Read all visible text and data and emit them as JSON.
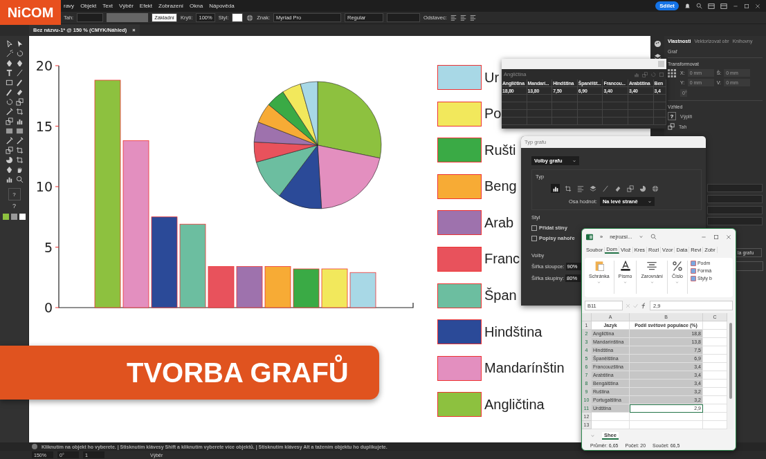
{
  "app": {
    "logo": "NiCOM",
    "menu": [
      "ravy",
      "Objekt",
      "Text",
      "Výběr",
      "Efekt",
      "Zobrazení",
      "Okna",
      "Nápověda"
    ],
    "share_button": "Sdílet"
  },
  "control_bar": {
    "stroke_label": "Tah:",
    "stroke_profile": "Základní",
    "opacity_label": "Krytí:",
    "opacity": "100%",
    "style_label": "Styl:",
    "char_label": "Znak:",
    "font": "Myriad Pro",
    "font_style": "Regular",
    "paragraph_label": "Odstavec:"
  },
  "document_tab": {
    "title": "Bez názvu-1* @ 150 % (CMYK/Náhled)",
    "close": "×"
  },
  "toolbar": {
    "fill_mark": "?",
    "stroke_mark": "?"
  },
  "canvas": {
    "chart_data": {
      "type": "bar",
      "ylim": [
        0,
        20
      ],
      "yticks": [
        0,
        5,
        10,
        15,
        20
      ],
      "series": [
        {
          "color": "#8dc13f",
          "values": [
            18.8
          ]
        },
        {
          "color": "#e38fbf",
          "values": [
            13.8
          ]
        },
        {
          "color": "#2b4a98",
          "values": [
            7.5
          ]
        },
        {
          "color": "#6cbea0",
          "values": [
            6.9
          ]
        },
        {
          "color": "#e8525c",
          "values": [
            3.4
          ]
        },
        {
          "color": "#9e72ad",
          "values": [
            3.4
          ]
        },
        {
          "color": "#f7ab35",
          "values": [
            3.4
          ]
        },
        {
          "color": "#3aaa45",
          "values": [
            3.2
          ]
        },
        {
          "color": "#f2e85c",
          "values": [
            3.2
          ]
        },
        {
          "color": "#a8d8e6",
          "values": [
            2.9
          ]
        }
      ]
    },
    "legend": [
      {
        "label": "Ur",
        "color": "#a8d8e6"
      },
      {
        "label": "Po",
        "color": "#f2e85c"
      },
      {
        "label": "Rušti",
        "color": "#3aaa45"
      },
      {
        "label": "Beng",
        "color": "#f7ab35"
      },
      {
        "label": "Arab",
        "color": "#9e72ad"
      },
      {
        "label": "Franc",
        "color": "#e8525c"
      },
      {
        "label": "Špan",
        "color": "#6cbea0"
      },
      {
        "label": "Hindština",
        "color": "#2b4a98"
      },
      {
        "label": "Mandarínštin",
        "color": "#e38fbf"
      },
      {
        "label": "Angličtina",
        "color": "#8dc13f"
      }
    ]
  },
  "banner": "TVORBA GRAFŮ",
  "properties_panel": {
    "tabs": [
      {
        "label": "Vlastnosti",
        "selected": true
      },
      {
        "label": "Vektorizovat obr",
        "selected": false
      },
      {
        "label": "Knihovny",
        "selected": false
      }
    ],
    "object": "Graf",
    "transform_title": "Transformovat",
    "fields": [
      {
        "label": "X:",
        "value": "0 mm"
      },
      {
        "label": "Š:",
        "value": "0 mm"
      },
      {
        "label": "Y:",
        "value": "0 mm"
      },
      {
        "label": "V:",
        "value": "0 mm"
      }
    ],
    "angle": "0°",
    "appearance_title": "Vzhled",
    "fill_mark": "?",
    "fill_label": "Výplň",
    "stroke_label": "Tah",
    "graph_button": "la grafu"
  },
  "data_window": {
    "cell_input": "Angličtina",
    "columns": [
      "Angličtina",
      "Mandarí...",
      "Hindština",
      "Španělšt...",
      "Francou...",
      "Arabština",
      "Ben"
    ],
    "values": [
      "18,80",
      "13,80",
      "7,50",
      "6,90",
      "3,40",
      "3,40",
      "3,4"
    ]
  },
  "chart_type_dialog": {
    "title": "Typ grafu",
    "section_dropdown": "Volby grafu",
    "type_title": "Typ",
    "chart_types": [
      {
        "kind": "column",
        "selected": true
      },
      {
        "kind": "stacked-column",
        "selected": false
      },
      {
        "kind": "bar",
        "selected": false
      },
      {
        "kind": "stacked-bar",
        "selected": false
      },
      {
        "kind": "line",
        "selected": false
      },
      {
        "kind": "area",
        "selected": false
      },
      {
        "kind": "scatter",
        "selected": false
      },
      {
        "kind": "pie",
        "selected": false
      },
      {
        "kind": "radar",
        "selected": false
      }
    ],
    "axis_label": "Osa hodnot:",
    "axis_value": "Na levé straně",
    "style_title": "Styl",
    "checkboxes": [
      {
        "label": "Přidat stíny",
        "checked": false
      },
      {
        "label": "Popisy nahoře",
        "checked": false
      }
    ],
    "options_title": "Volby",
    "options": [
      {
        "label": "Šířka sloupce:",
        "value": "90%"
      },
      {
        "label": "Šířka skupiny:",
        "value": "80%"
      }
    ]
  },
  "excel": {
    "file_name": "nejrozsi...",
    "more": "»",
    "ribbon_tabs": [
      {
        "label": "Soubor",
        "selected": false
      },
      {
        "label": "Dom",
        "selected": true
      },
      {
        "label": "Vlož",
        "selected": false
      },
      {
        "label": "Kres",
        "selected": false
      },
      {
        "label": "Rozl",
        "selected": false
      },
      {
        "label": "Vzor",
        "selected": false
      },
      {
        "label": "Data",
        "selected": false
      },
      {
        "label": "Revi",
        "selected": false
      },
      {
        "label": "Zobr",
        "selected": false
      }
    ],
    "ribbon_groups": [
      "Schránka",
      "Písmo",
      "Zarovnání",
      "Číslo"
    ],
    "style_items": [
      "Podm",
      "Formá",
      "Styly b"
    ],
    "name_box": "B11",
    "formula": "2,9",
    "columns": [
      "A",
      "B",
      "C"
    ],
    "rows": [
      {
        "label": "1",
        "a": "Jazyk",
        "b": "Podíl světové populace (%)",
        "kind": "header",
        "selected": false,
        "active": false
      },
      {
        "label": "2",
        "a": "Angličtina",
        "b": "18,8",
        "kind": "data",
        "selected": true,
        "active": false
      },
      {
        "label": "3",
        "a": "Mandarínština",
        "b": "13,8",
        "kind": "data",
        "selected": true,
        "active": false
      },
      {
        "label": "4",
        "a": "Hindština",
        "b": "7,5",
        "kind": "data",
        "selected": true,
        "active": false
      },
      {
        "label": "5",
        "a": "Španělština",
        "b": "6,9",
        "kind": "data",
        "selected": true,
        "active": false
      },
      {
        "label": "6",
        "a": "Francouzština",
        "b": "3,4",
        "kind": "data",
        "selected": true,
        "active": false
      },
      {
        "label": "7",
        "a": "Arabština",
        "b": "3,4",
        "kind": "data",
        "selected": true,
        "active": false
      },
      {
        "label": "8",
        "a": "Bengálština",
        "b": "3,4",
        "kind": "data",
        "selected": true,
        "active": false
      },
      {
        "label": "9",
        "a": "Ruština",
        "b": "3,2",
        "kind": "data",
        "selected": true,
        "active": false
      },
      {
        "label": "10",
        "a": "Portugalština",
        "b": "3,2",
        "kind": "data",
        "selected": true,
        "active": false
      },
      {
        "label": "11",
        "a": "Urdština",
        "b": "2,9",
        "kind": "data",
        "selected": true,
        "active": true
      },
      {
        "label": "12",
        "kind": "empty",
        "selected": false,
        "active": false
      },
      {
        "label": "13",
        "kind": "empty",
        "selected": false,
        "active": false
      }
    ],
    "sheet_tab": "Shee",
    "status": [
      "Průměr: 6,65",
      "Počet: 20",
      "Součet: 66,5"
    ]
  },
  "status_bar": {
    "hint": "Kliknutím na objekt ho vyberete.  |  Stisknutím klávesy Shift a kliknutím vyberete více objektů.  |  Stisknutím klávesy Alt a tažením objektu ho duplikujete.",
    "zoom": "150%",
    "rotation": "0°",
    "artboard": "1",
    "tool": "Výběr"
  }
}
